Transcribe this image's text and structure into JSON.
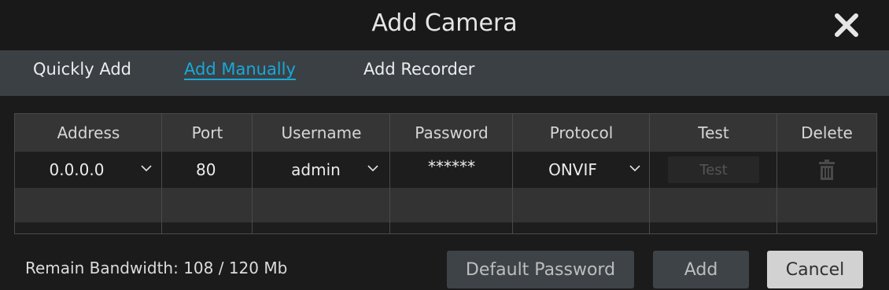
{
  "dialog": {
    "title": "Add Camera"
  },
  "tabs": [
    {
      "label": "Quickly Add",
      "active": false
    },
    {
      "label": "Add Manually",
      "active": true
    },
    {
      "label": "Add Recorder",
      "active": false
    }
  ],
  "table": {
    "headers": [
      "Address",
      "Port",
      "Username",
      "Password",
      "Protocol",
      "Test",
      "Delete"
    ],
    "rows": [
      {
        "address": "0.0.0.0",
        "port": "80",
        "username": "admin",
        "password": "******",
        "protocol": "ONVIF",
        "test": "Test"
      }
    ]
  },
  "footer": {
    "bandwidth": "Remain Bandwidth: 108 / 120 Mb",
    "default_password": "Default Password",
    "add": "Add",
    "cancel": "Cancel"
  },
  "colors": {
    "accent": "#18a9d8",
    "tabbar": "#3b4045",
    "background": "#1b1b1b"
  },
  "icons": {
    "close": "close-icon",
    "dropdown": "chevron-down-icon",
    "delete": "trash-icon"
  }
}
